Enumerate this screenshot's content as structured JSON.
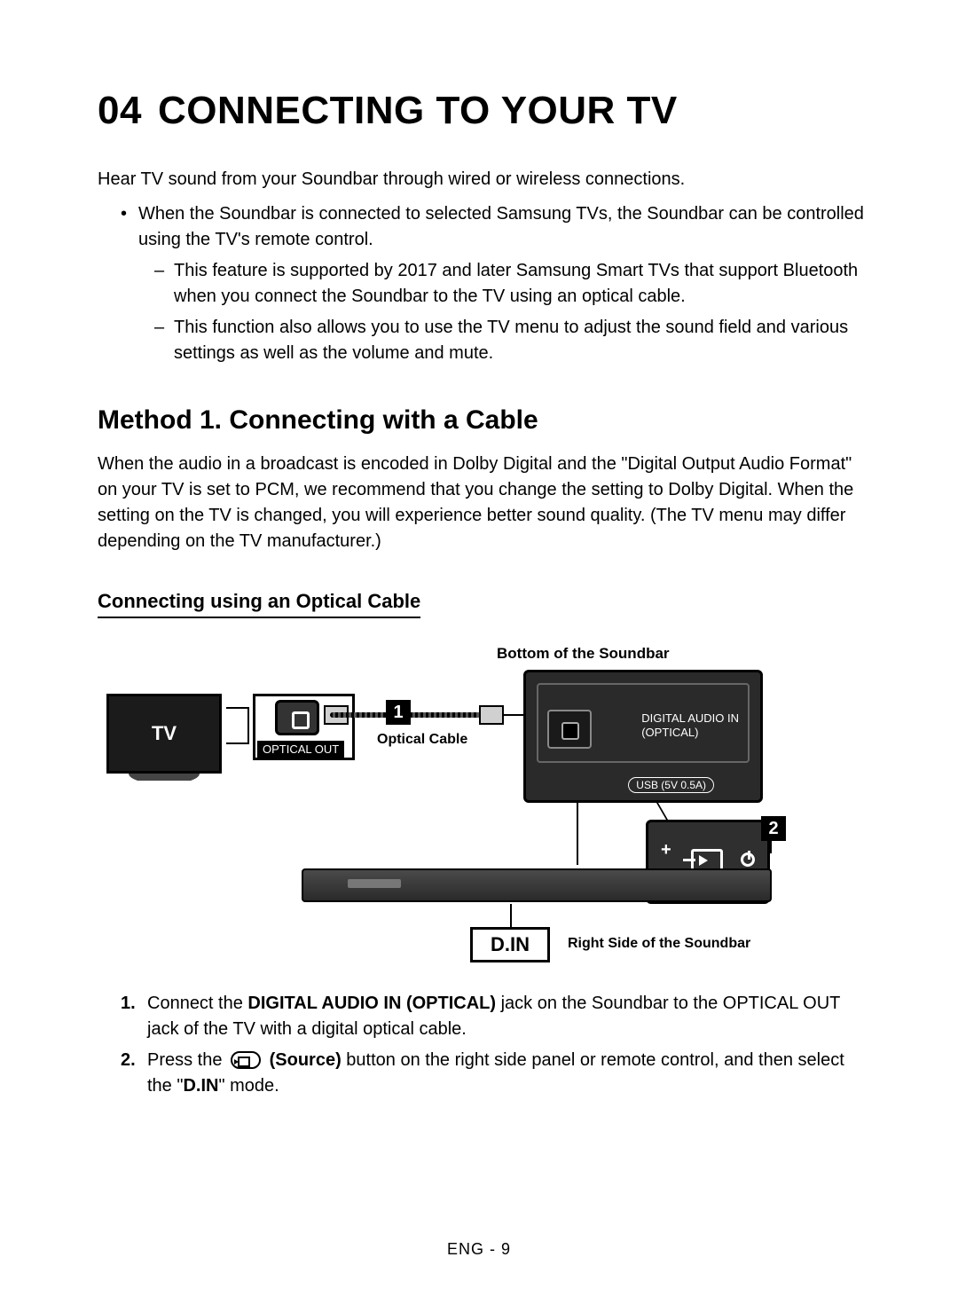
{
  "chapter": {
    "num": "04",
    "title": "CONNECTING TO YOUR TV"
  },
  "intro": "Hear TV sound from your Soundbar through wired or wireless connections.",
  "bullet1": "When the Soundbar is connected to selected Samsung TVs, the Soundbar can be controlled using the TV's remote control.",
  "dash1": "This feature is supported by 2017 and later Samsung Smart TVs that support Bluetooth when you connect the Soundbar to the TV using an optical cable.",
  "dash2": "This function also allows you to use the TV menu to adjust the sound field and various settings as well as the volume and mute.",
  "h2": "Method 1. Connecting with a Cable",
  "method_para": "When the audio in a broadcast is encoded in Dolby Digital and the \"Digital Output Audio Format\" on your TV is set to PCM, we recommend that you change the setting to Dolby Digital. When the setting on the TV is changed, you will experience better sound quality. (The TV menu may differ depending on the TV manufacturer.)",
  "h3": "Connecting using an Optical Cable",
  "diagram": {
    "top_label": "Bottom of the Soundbar",
    "tv": "TV",
    "optical_out": "OPTICAL OUT",
    "cable_label": "Optical Cable",
    "badge1": "1",
    "port_optical_line1": "DIGITAL AUDIO IN",
    "port_optical_line2": "(OPTICAL)",
    "port_usb": "USB (5V 0.5A)",
    "badge2": "2",
    "right_label": "Right Side of the Soundbar",
    "din": "D.IN"
  },
  "step1": {
    "a": "Connect the ",
    "b": "DIGITAL AUDIO IN (OPTICAL)",
    "c": " jack on the Soundbar to the OPTICAL OUT jack of the TV with a digital optical cable."
  },
  "step2": {
    "a": "Press the ",
    "b": "(Source)",
    "c": " button on the right side panel or remote control, and then select the \"",
    "d": "D.IN",
    "e": "\" mode."
  },
  "footer": "ENG - 9"
}
